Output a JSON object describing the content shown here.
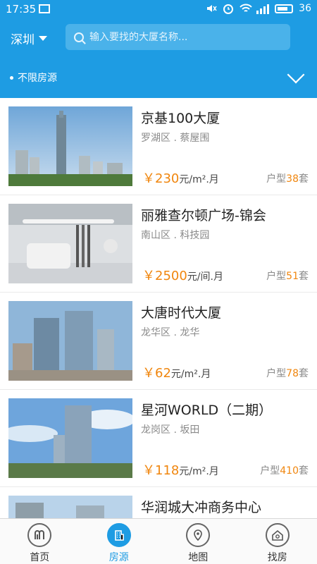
{
  "status_bar": {
    "time": "17:35",
    "network": "4G",
    "battery": "36"
  },
  "header": {
    "city": "深圳",
    "search_placeholder": "输入要找的大厦名称...",
    "filter_label": "不限房源"
  },
  "listings": [
    {
      "name": "京基100大厦",
      "area": "罗湖区 . 蔡屋围",
      "price_symbol": "￥",
      "price": "230",
      "unit": "元/m².月",
      "type_label": "户型",
      "count": "38",
      "count_suffix": "套"
    },
    {
      "name": "丽雅查尔顿广场-锦会",
      "area": "南山区 . 科技园",
      "price_symbol": "￥",
      "price": "2500",
      "unit": "元/间.月",
      "type_label": "户型",
      "count": "51",
      "count_suffix": "套"
    },
    {
      "name": "大唐时代大厦",
      "area": "龙华区 . 龙华",
      "price_symbol": "￥",
      "price": "62",
      "unit": "元/m².月",
      "type_label": "户型",
      "count": "78",
      "count_suffix": "套"
    },
    {
      "name": "星河WORLD（二期）",
      "area": "龙岗区 . 坂田",
      "price_symbol": "￥",
      "price": "118",
      "unit": "元/m².月",
      "type_label": "户型",
      "count": "410",
      "count_suffix": "套"
    },
    {
      "name": "华润城大冲商务中心",
      "area": "",
      "price_symbol": "",
      "price": "",
      "unit": "",
      "type_label": "",
      "count": "",
      "count_suffix": ""
    }
  ],
  "tabbar": {
    "items": [
      {
        "label": "首页",
        "icon": "home-logo-icon"
      },
      {
        "label": "房源",
        "icon": "building-icon"
      },
      {
        "label": "地图",
        "icon": "map-pin-icon"
      },
      {
        "label": "找房",
        "icon": "house-search-icon"
      }
    ]
  },
  "colors": {
    "brand": "#1e9ce3",
    "accent": "#f0860e"
  }
}
